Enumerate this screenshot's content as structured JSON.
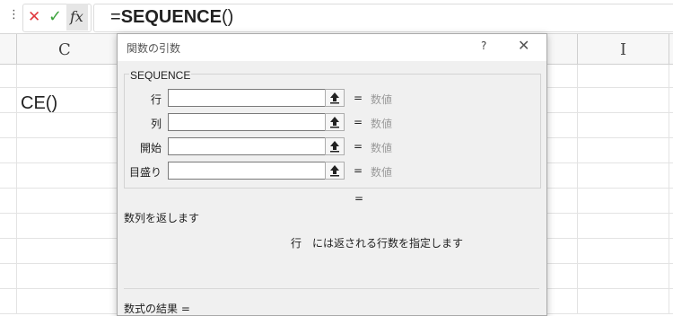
{
  "formula_bar": {
    "dots": "⋮",
    "cancel_icon": "✕",
    "enter_icon": "✓",
    "fx_label": "fx",
    "formula_prefix": "=",
    "formula_name": "SEQUENCE",
    "formula_suffix": "()"
  },
  "sheet": {
    "columns": [
      {
        "label": "C"
      },
      {
        "label": "I"
      }
    ],
    "cell_text": "CE()"
  },
  "dialog": {
    "title": "関数の引数",
    "help_label": "?",
    "close_label": "✕",
    "function_name": "SEQUENCE",
    "args": [
      {
        "label": "行",
        "eq": "=",
        "value": "数値"
      },
      {
        "label": "列",
        "eq": "=",
        "value": "数値"
      },
      {
        "label": "開始",
        "eq": "=",
        "value": "数値"
      },
      {
        "label": "目盛り",
        "eq": "=",
        "value": "数値"
      }
    ],
    "result_eq": "=",
    "description": "数列を返します",
    "arg_description": "行　には返される行数を指定します",
    "formula_result": "数式の結果 ="
  },
  "colors": {
    "cancel": "#e0393e",
    "enter": "#3ca33c",
    "grid": "#e3e3e3",
    "dialog_bg": "#f0f0f0"
  }
}
